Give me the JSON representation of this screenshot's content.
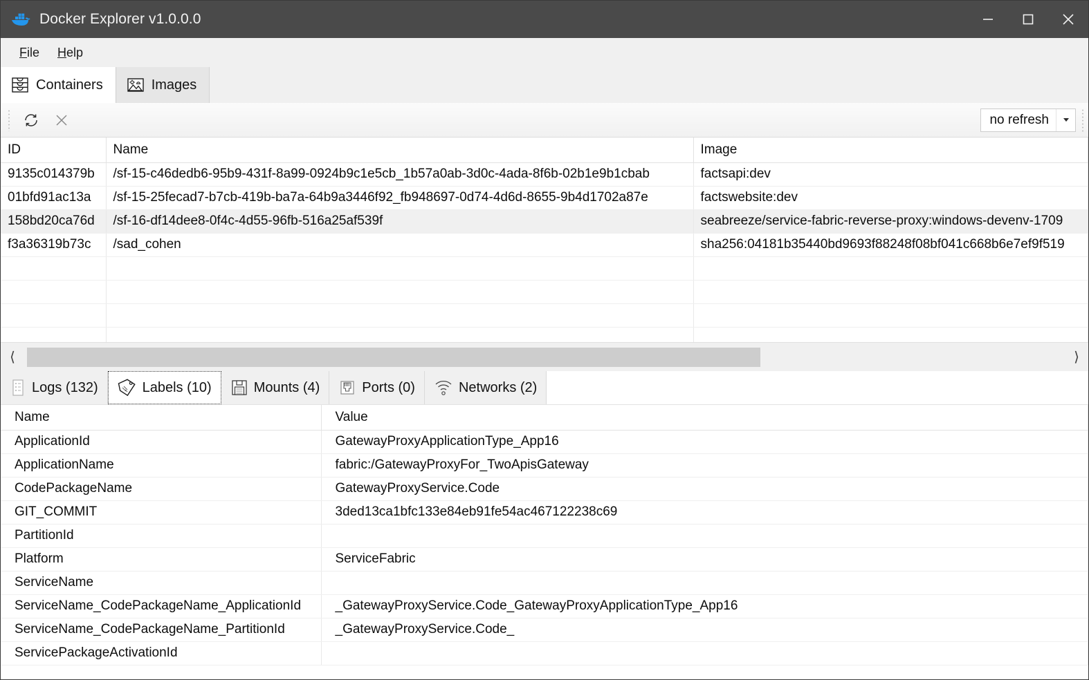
{
  "window": {
    "title": "Docker Explorer v1.0.0.0",
    "logo_icon": "docker-whale-icon",
    "buttons": {
      "minimize": "minimize-icon",
      "maximize": "maximize-icon",
      "close": "close-icon"
    }
  },
  "menubar": {
    "items": [
      {
        "label": "File",
        "mnemonic": "F"
      },
      {
        "label": "Help",
        "mnemonic": "H"
      }
    ]
  },
  "main_tabs": {
    "selected": "Containers",
    "items": [
      {
        "label": "Containers",
        "icon": "containers-stack-icon",
        "active": true
      },
      {
        "label": "Images",
        "icon": "picture-mountain-icon",
        "active": false
      }
    ]
  },
  "toolbar": {
    "refresh_icon": "refresh-circular-arrows-icon",
    "stop_icon": "close-x-icon",
    "refresh_interval": {
      "value": "no refresh",
      "arrow_icon": "chevron-down-icon"
    }
  },
  "containers_grid": {
    "columns": [
      "ID",
      "Name",
      "Image"
    ],
    "rows": [
      {
        "id": "9135c014379b",
        "name": "/sf-15-c46dedb6-95b9-431f-8a99-0924b9c1e5cb_1b57a0ab-3d0c-4ada-8f6b-02b1e9b1cbab",
        "image": "factsapi:dev",
        "selected": false
      },
      {
        "id": "01bfd91ac13a",
        "name": "/sf-15-25fecad7-b7cb-419b-ba7a-64b9a3446f92_fb948697-0d74-4d6d-8655-9b4d1702a87e",
        "image": "factswebsite:dev",
        "selected": false
      },
      {
        "id": "158bd20ca76d",
        "name": "/sf-16-df14dee8-0f4c-4d55-96fb-516a25af539f",
        "image": "seabreeze/service-fabric-reverse-proxy:windows-devenv-1709",
        "selected": true
      },
      {
        "id": "f3a36319b73c",
        "name": "/sad_cohen",
        "image": "sha256:04181b35440bd9693f88248f08bf041c668b6e7ef9f519",
        "selected": false
      },
      {
        "id": "",
        "name": "",
        "image": "",
        "selected": false
      },
      {
        "id": "",
        "name": "",
        "image": "",
        "selected": false
      },
      {
        "id": "",
        "name": "",
        "image": "",
        "selected": false
      },
      {
        "id": "",
        "name": "",
        "image": "",
        "selected": false
      }
    ]
  },
  "hscroll": {
    "left_arrow_icon": "chevron-left-icon",
    "right_arrow_icon": "chevron-right-icon"
  },
  "detail_tabs": {
    "selected": "Labels (10)",
    "items": [
      {
        "label": "Logs (132)",
        "icon": "log-list-icon",
        "active": false
      },
      {
        "label": "Labels (10)",
        "icon": "tag-label-icon",
        "active": true
      },
      {
        "label": "Mounts (4)",
        "icon": "floppy-disk-icon",
        "active": false
      },
      {
        "label": "Ports (0)",
        "icon": "ethernet-port-icon",
        "active": false
      },
      {
        "label": "Networks (2)",
        "icon": "wifi-signal-icon",
        "active": false
      }
    ]
  },
  "labels_grid": {
    "columns": [
      "Name",
      "Value"
    ],
    "rows": [
      {
        "name": "ApplicationId",
        "value": "GatewayProxyApplicationType_App16"
      },
      {
        "name": "ApplicationName",
        "value": "fabric:/GatewayProxyFor_TwoApisGateway"
      },
      {
        "name": "CodePackageName",
        "value": "GatewayProxyService.Code"
      },
      {
        "name": "GIT_COMMIT",
        "value": "3ded13ca1bfc133e84eb91fe54ac467122238c69"
      },
      {
        "name": "PartitionId",
        "value": ""
      },
      {
        "name": "Platform",
        "value": "ServiceFabric"
      },
      {
        "name": "ServiceName",
        "value": ""
      },
      {
        "name": "ServiceName_CodePackageName_ApplicationId",
        "value": "_GatewayProxyService.Code_GatewayProxyApplicationType_App16"
      },
      {
        "name": "ServiceName_CodePackageName_PartitionId",
        "value": "_GatewayProxyService.Code_"
      },
      {
        "name": "ServicePackageActivationId",
        "value": ""
      }
    ]
  },
  "colors": {
    "titlebar_bg": "#4a4a4a",
    "chrome_bg": "#f0f0f0",
    "selection_bg": "#f0f0f0",
    "grid_bg": "#ffffff",
    "text": "#0d0d0d"
  }
}
